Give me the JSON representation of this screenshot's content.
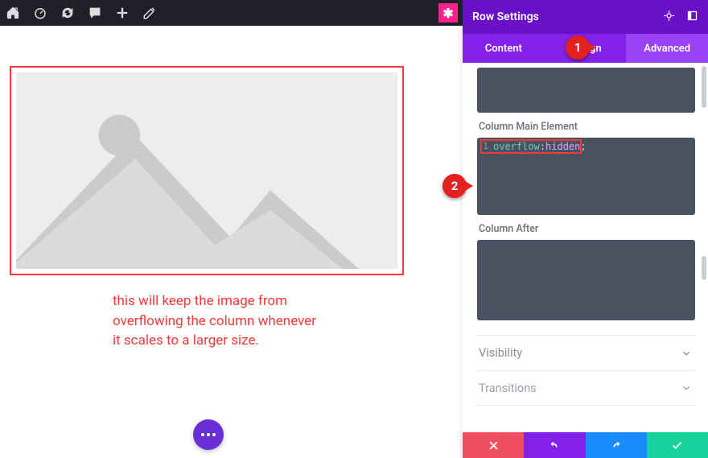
{
  "topbar": {
    "icons": [
      "home-icon",
      "gauge-icon",
      "sync-icon",
      "comment-icon",
      "plus-icon",
      "pencil-icon"
    ],
    "brand_glyph": "✱"
  },
  "canvas": {
    "caption": "this will keep the image from overflowing the column whenever it scales to a larger size."
  },
  "panel": {
    "title": "Row Settings",
    "header_icons": [
      "target-icon",
      "collapse-icon"
    ],
    "tabs": [
      {
        "label": "Content",
        "active": false
      },
      {
        "label": "Design",
        "active": false
      },
      {
        "label": "Advanced",
        "active": true
      }
    ],
    "fields": {
      "top_box_value": "",
      "col_main_label": "Column Main Element",
      "col_main_code_line_no": "1",
      "col_main_code_kw": "overflow",
      "col_main_code_val": "hidden",
      "col_after_label": "Column After",
      "col_after_value": ""
    },
    "accordions": [
      "Visibility",
      "Transitions"
    ]
  },
  "annotations": {
    "one": "1",
    "two": "2"
  },
  "actionbar": {
    "buttons": [
      "close",
      "undo",
      "redo",
      "save"
    ]
  }
}
